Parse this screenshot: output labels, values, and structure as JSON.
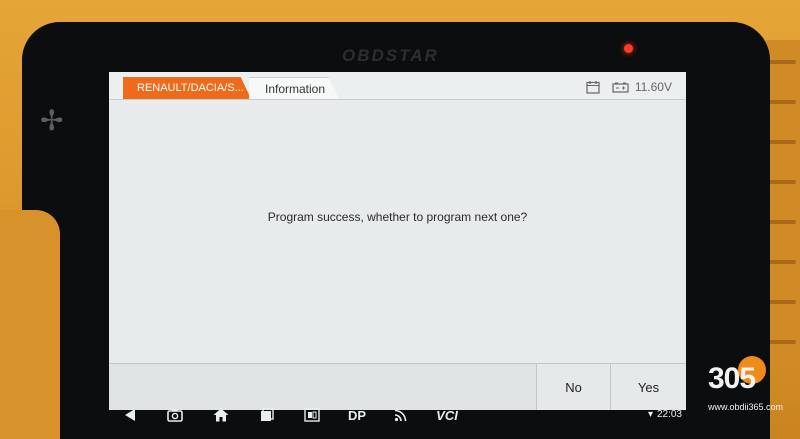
{
  "device": {
    "brand": "OBDSTAR"
  },
  "tabs": {
    "active_label": "RENAULT/DACIA/S...",
    "info_label": "Information"
  },
  "status": {
    "voltage": "11.60V",
    "time": "22:03"
  },
  "dialog": {
    "message": "Program success, whether to program next one?"
  },
  "buttons": {
    "no_label": "No",
    "yes_label": "Yes"
  },
  "navbar": {
    "dp_label": "DP",
    "vci_label": "VCI"
  },
  "watermark": {
    "text": "305",
    "url": "www.obdii365.com"
  },
  "colors": {
    "accent_orange": "#ee6b1c",
    "device_yellow": "#e6a537",
    "screen_bg": "#e7ebec",
    "led_red": "#ff3b2a"
  }
}
